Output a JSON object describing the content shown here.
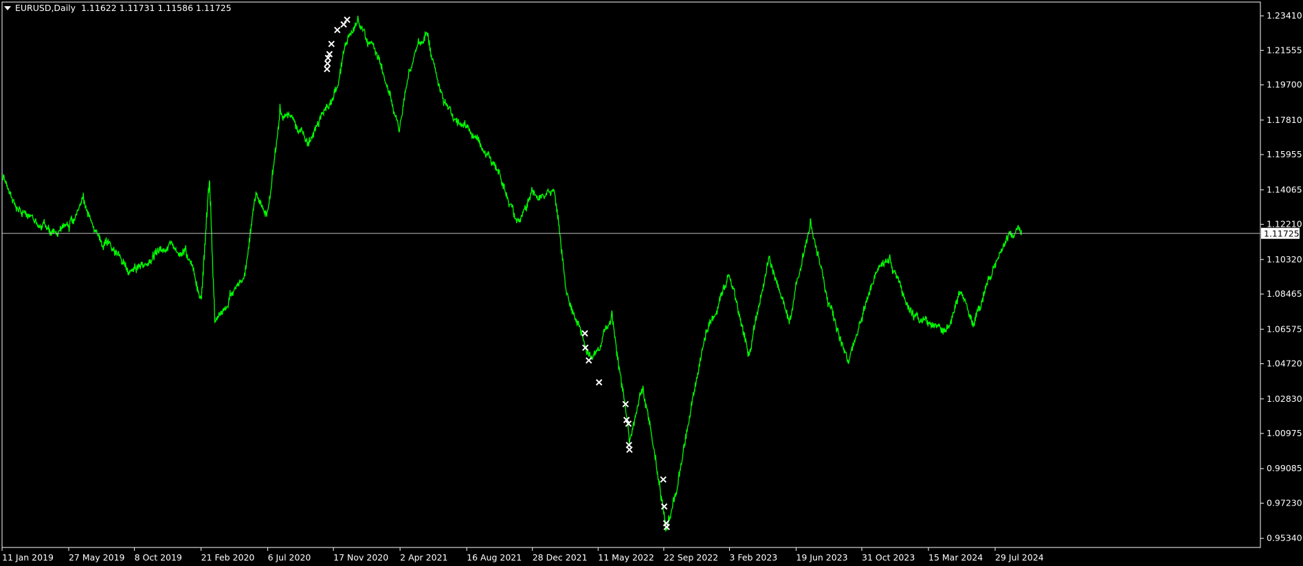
{
  "header": {
    "symbol": "EURUSD,Daily",
    "ohlc": "1.11622 1.11731 1.11586 1.11725"
  },
  "current_price": {
    "label": "1.11725",
    "value": 1.11725
  },
  "colors": {
    "background": "#000000",
    "series": "#00ff00",
    "axis": "#ffffff",
    "markers": "#ffffff",
    "price_line": "#c0c0c0"
  },
  "chart_data": {
    "type": "line",
    "title": "EURUSD,Daily",
    "xlabel": "",
    "ylabel": "",
    "ylim": [
      0.9485,
      1.2415
    ],
    "grid": false,
    "y_ticks": [
      "1.23410",
      "1.21555",
      "1.19700",
      "1.17810",
      "1.15955",
      "1.14065",
      "1.12210",
      "1.10320",
      "1.08465",
      "1.06575",
      "1.04720",
      "1.02830",
      "1.00975",
      "0.99085",
      "0.97230",
      "0.95340"
    ],
    "x_ticks": [
      "11 Jan 2019",
      "27 May 2019",
      "8 Oct 2019",
      "21 Feb 2020",
      "6 Jul 2020",
      "17 Nov 2020",
      "2 Apr 2021",
      "16 Aug 2021",
      "28 Dec 2021",
      "11 May 2022",
      "22 Sep 2022",
      "3 Feb 2023",
      "19 Jun 2023",
      "31 Oct 2023",
      "15 Mar 2024",
      "29 Jul 2024"
    ],
    "series": [
      {
        "type": "line",
        "x": [
          "2019-01-11",
          "2019-02-15",
          "2019-03-20",
          "2019-04-25",
          "2019-05-27",
          "2019-06-25",
          "2019-07-25",
          "2019-08-25",
          "2019-09-25",
          "2019-10-08",
          "2019-11-15",
          "2019-12-20",
          "2020-01-20",
          "2020-02-21",
          "2020-03-09",
          "2020-03-20",
          "2020-04-20",
          "2020-05-20",
          "2020-06-10",
          "2020-07-06",
          "2020-07-31",
          "2020-08-20",
          "2020-09-25",
          "2020-10-20",
          "2020-11-17",
          "2020-12-15",
          "2021-01-06",
          "2021-02-15",
          "2021-03-31",
          "2021-04-20",
          "2021-05-25",
          "2021-06-30",
          "2021-07-30",
          "2021-08-16",
          "2021-09-30",
          "2021-11-24",
          "2021-12-15",
          "2021-12-28",
          "2022-02-10",
          "2022-03-07",
          "2022-04-28",
          "2022-05-11",
          "2022-06-08",
          "2022-07-14",
          "2022-08-10",
          "2022-09-28",
          "2022-10-25",
          "2022-12-15",
          "2023-02-01",
          "2023-03-15",
          "2023-04-25",
          "2023-06-05",
          "2023-07-18",
          "2023-08-25",
          "2023-10-03",
          "2023-11-20",
          "2023-12-27",
          "2024-02-14",
          "2024-04-16",
          "2024-05-20",
          "2024-06-14",
          "2024-07-17",
          "2024-08-26",
          "2024-09-20"
        ],
        "y": [
          1.147,
          1.131,
          1.125,
          1.118,
          1.119,
          1.138,
          1.116,
          1.108,
          1.096,
          1.1,
          1.106,
          1.112,
          1.11,
          1.082,
          1.145,
          1.07,
          1.085,
          1.095,
          1.135,
          1.13,
          1.185,
          1.18,
          1.165,
          1.18,
          1.19,
          1.22,
          1.233,
          1.211,
          1.172,
          1.205,
          1.225,
          1.187,
          1.177,
          1.175,
          1.16,
          1.125,
          1.13,
          1.14,
          1.14,
          1.085,
          1.05,
          1.055,
          1.075,
          1.005,
          1.035,
          0.958,
          0.99,
          1.06,
          1.095,
          1.052,
          1.105,
          1.07,
          1.125,
          1.08,
          1.048,
          1.09,
          1.105,
          1.072,
          1.065,
          1.085,
          1.068,
          1.093,
          1.118,
          1.118
        ]
      },
      {
        "type": "scatter",
        "marker": "x",
        "x": [
          "2020-11-04",
          "2020-11-05",
          "2020-11-06",
          "2020-11-09",
          "2020-11-13",
          "2020-11-25",
          "2020-12-08",
          "2020-12-15",
          "2022-04-14",
          "2022-04-15",
          "2022-04-22",
          "2022-05-13",
          "2022-07-06",
          "2022-07-08",
          "2022-07-12",
          "2022-07-13",
          "2022-07-14",
          "2022-09-21",
          "2022-09-23",
          "2022-09-27",
          "2022-09-28"
        ],
        "y": [
          1.2055,
          1.2085,
          1.2115,
          1.2135,
          1.219,
          1.2265,
          1.2295,
          1.232,
          1.0635,
          1.0558,
          1.049,
          1.0372,
          1.0255,
          1.017,
          1.015,
          1.0035,
          1.001,
          0.985,
          0.9705,
          0.9615,
          0.9595
        ]
      }
    ]
  }
}
